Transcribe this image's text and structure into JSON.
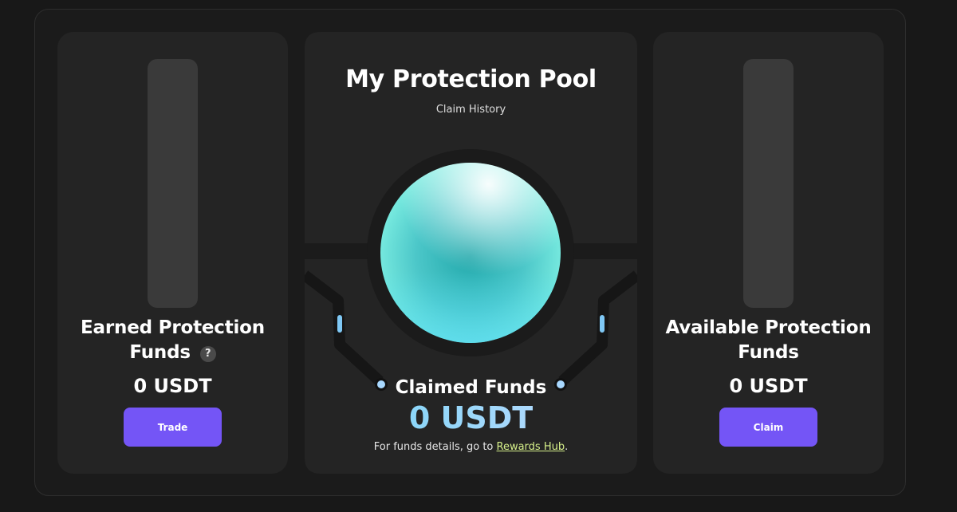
{
  "pool": {
    "title": "My Protection Pool",
    "claim_history_label": "Claim History"
  },
  "earned": {
    "title_line1": "Earned Protection",
    "title_line2": "Funds",
    "help_icon": "?",
    "amount": "0 USDT",
    "button_label": "Trade"
  },
  "claimed": {
    "label": "Claimed Funds",
    "amount": "0 USDT",
    "details_prefix": "For funds details, go to",
    "details_link": "Rewards Hub",
    "details_suffix": "."
  },
  "available": {
    "title_line1": "Available Protection",
    "title_line2": "Funds",
    "amount": "0 USDT",
    "button_label": "Claim"
  },
  "colors": {
    "background": "#181818",
    "panel": "#242424",
    "button": "#7455f6",
    "link": "#d6f08a",
    "orb_center": "#21a8ab",
    "orb_edge": "#7ff0e3",
    "claimed_amount": "#6fd3f6"
  },
  "icons": {
    "help": "question-icon",
    "orb": "pool-orb-graphic"
  }
}
